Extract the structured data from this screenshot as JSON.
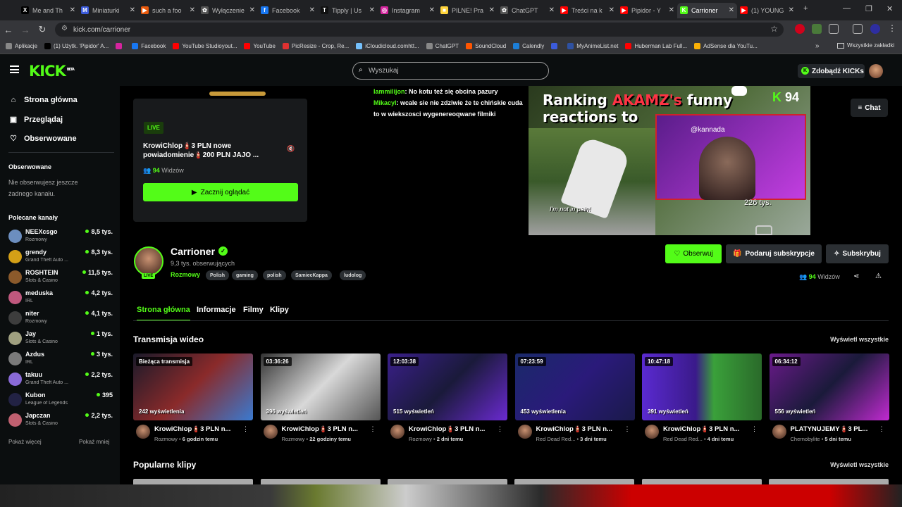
{
  "browser": {
    "tabs": [
      {
        "label": "Me and Th",
        "color": "#000000",
        "glyph": "X"
      },
      {
        "label": "Miniaturki",
        "color": "#3b5bdb",
        "glyph": "M"
      },
      {
        "label": "such a foo",
        "color": "#e8590c",
        "glyph": "▶"
      },
      {
        "label": "Wyłączenie",
        "color": "#555555",
        "glyph": "✿"
      },
      {
        "label": "Facebook",
        "color": "#1877f2",
        "glyph": "f"
      },
      {
        "label": "Tipply | Us",
        "color": "#111111",
        "glyph": "T"
      },
      {
        "label": "Instagram",
        "color": "#d6249f",
        "glyph": "◎"
      },
      {
        "label": "PILNE! Pra",
        "color": "#ffd43b",
        "glyph": "■"
      },
      {
        "label": "ChatGPT",
        "color": "#555555",
        "glyph": "✿"
      },
      {
        "label": "Treści na k",
        "color": "#ff0000",
        "glyph": "▶"
      },
      {
        "label": "Pipidor - Y",
        "color": "#ff0000",
        "glyph": "▶"
      },
      {
        "label": "Carrioner",
        "color": "#53fc18",
        "glyph": "K"
      },
      {
        "label": "(1) YOUNG",
        "color": "#ff0000",
        "glyph": "▶"
      }
    ],
    "url": "kick.com/carrioner",
    "bookmarks": [
      {
        "label": "Aplikacje",
        "color": "#888888"
      },
      {
        "label": "(1) Użytk. 'Pipidor' A...",
        "color": "#000000"
      },
      {
        "label": "",
        "color": "#d6249f"
      },
      {
        "label": "Facebook",
        "color": "#1877f2"
      },
      {
        "label": "YouTube Studioyout...",
        "color": "#ff0000"
      },
      {
        "label": "YouTube",
        "color": "#ff0000"
      },
      {
        "label": "PicResize - Crop, Re...",
        "color": "#e03131"
      },
      {
        "label": "iCloudicloud.comhtt...",
        "color": "#74c0fc"
      },
      {
        "label": "ChatGPT",
        "color": "#888888"
      },
      {
        "label": "SoundCloud",
        "color": "#ff5500"
      },
      {
        "label": "Calendly",
        "color": "#1c7ed6"
      },
      {
        "label": "",
        "color": "#3b5bdb"
      },
      {
        "label": "MyAnimeList.net",
        "color": "#2e51a2"
      },
      {
        "label": "Huberman Lab Full...",
        "color": "#ff0000"
      },
      {
        "label": "AdSense dla YouTu...",
        "color": "#fab005"
      }
    ],
    "all_bookmarks": "Wszystkie zakładki"
  },
  "kick": {
    "logo": "KICK",
    "beta": "BETA",
    "search_placeholder": "Wyszukaj",
    "get_kicks": "Zdobądź KICKs",
    "nav": [
      "Strona główna",
      "Przeglądaj",
      "Obserwowane"
    ],
    "followed_title": "Obserwowane",
    "followed_empty": "Nie obserwujesz jeszcze żadnego kanału.",
    "recommended_title": "Polecane kanały",
    "channels": [
      {
        "name": "NEEXcsgo",
        "category": "Rozmowy",
        "viewers": "8,5 tys.",
        "color": "#6c8ebf"
      },
      {
        "name": "grendy",
        "category": "Grand Theft Auto ...",
        "viewers": "8,3 tys.",
        "color": "#d4a017"
      },
      {
        "name": "ROSHTEIN",
        "category": "Slots & Casino",
        "viewers": "11,5 tys.",
        "color": "#8b5a2b"
      },
      {
        "name": "meduska",
        "category": "IRL",
        "viewers": "4,2 tys.",
        "color": "#c0587e"
      },
      {
        "name": "niter",
        "category": "Rozmowy",
        "viewers": "4,1 tys.",
        "color": "#3d3d3d"
      },
      {
        "name": "Jay",
        "category": "Slots & Casino",
        "viewers": "1 tys.",
        "color": "#a0a080"
      },
      {
        "name": "Azdus",
        "category": "IRL",
        "viewers": "3 tys.",
        "color": "#7a7a7a"
      },
      {
        "name": "takuu",
        "category": "Grand Theft Auto ...",
        "viewers": "2,2 tys.",
        "color": "#8a6ad8"
      },
      {
        "name": "Kubon",
        "category": "League of Legends",
        "viewers": "395",
        "color": "#222244"
      },
      {
        "name": "Japczan",
        "category": "Slots & Casino",
        "viewers": "2,2 tys.",
        "color": "#c06070"
      }
    ],
    "show_more": "Pokaż więcej",
    "show_less": "Pokaż mniej"
  },
  "offline_card": {
    "badge": "LIVE",
    "title": "KrowiChlop🧯3 PLN nowe powiadomienie🧯200 PLN JAJO ...",
    "viewers_count": "94",
    "viewers_label": "Widzów",
    "start_button": "Zacznij oglądać"
  },
  "chat_overlay": {
    "line1_user": "Iammilijon",
    "line1_text": ": No kotu też się obcina pazury",
    "line2_user": "Mikacyl",
    "line2_text": ": wcale sie nie zdziwie że te chińskie cuda to w wiekszosci wygenereoqwane filmiki"
  },
  "video_overlay": {
    "title_part1": "Ranking",
    "title_part2": "AKAMZ's",
    "title_part3": "funny",
    "title_line2": "reactions to",
    "handle": "@kannada",
    "views": "226 tys.",
    "viewer_count": "94",
    "caption": "I'm not in pain!"
  },
  "chat_button": "Chat",
  "channel": {
    "name": "Carrioner",
    "live_badge": "LIVE",
    "followers": "9,3 tys. obserwujących",
    "category": "Rozmowy",
    "tags": [
      "Polish",
      "gaming",
      "polish",
      "SamiecKappa",
      "ludolog"
    ],
    "follow_button": "Obserwuj",
    "gift_button": "Podaruj subskrypcje",
    "subscribe_button": "Subskrybuj",
    "viewers_count": "94",
    "viewers_label": "Widzów"
  },
  "channel_tabs": [
    "Strona główna",
    "Informacje",
    "Filmy",
    "Klipy"
  ],
  "vods_title": "Transmisja wideo",
  "see_all": "Wyświetl wszystkie",
  "clips_title": "Popularne klipy",
  "vods": [
    {
      "duration": "Bieżąca transmisja",
      "views": "242 wyświetlenia",
      "title": "KrowiChlop🧯3 PLN n...",
      "category": "Rozmowy",
      "ago": "6 godzin temu",
      "bg": "linear-gradient(135deg,#1a1a2a,#8a2a2a 50%,#3a7ad0)"
    },
    {
      "duration": "03:36:26",
      "views": "396 wyświetleń",
      "title": "KrowiChlop🧯3 PLN n...",
      "category": "Rozmowy",
      "ago": "22 godziny temu",
      "bg": "linear-gradient(135deg,#333,#d8d8d8 50%,#555)"
    },
    {
      "duration": "12:03:38",
      "views": "515 wyświetleń",
      "title": "KrowiChlop🧯3 PLN n...",
      "category": "Rozmowy",
      "ago": "2 dni temu",
      "bg": "linear-gradient(135deg,#3a1f8a,#1a1a3a 50%,#6a2ad0)"
    },
    {
      "duration": "07:23:59",
      "views": "453 wyświetlenia",
      "title": "KrowiChlop🧯3 PLN n...",
      "category": "Red Dead Red...",
      "ago": "3 dni temu",
      "bg": "linear-gradient(135deg,#1a2a6a,#2a1a7a 50%,#1a1a4a)"
    },
    {
      "duration": "10:47:18",
      "views": "391 wyświetleń",
      "title": "KrowiChlop🧯3 PLN n...",
      "category": "Red Dead Red...",
      "ago": "4 dni temu",
      "bg": "linear-gradient(90deg,#5a2ad0,#3a1a8a 45%,#3aa03a 60%,#2a6a2a)"
    },
    {
      "duration": "06:34:12",
      "views": "556 wyświetleń",
      "title": "PLATYNUJEMY🧯3 PL...",
      "category": "Chernobylite",
      "ago": "5 dni temu",
      "bg": "linear-gradient(135deg,#6a1a8a,#1a1a3a 50%,#c02ad0)"
    }
  ]
}
